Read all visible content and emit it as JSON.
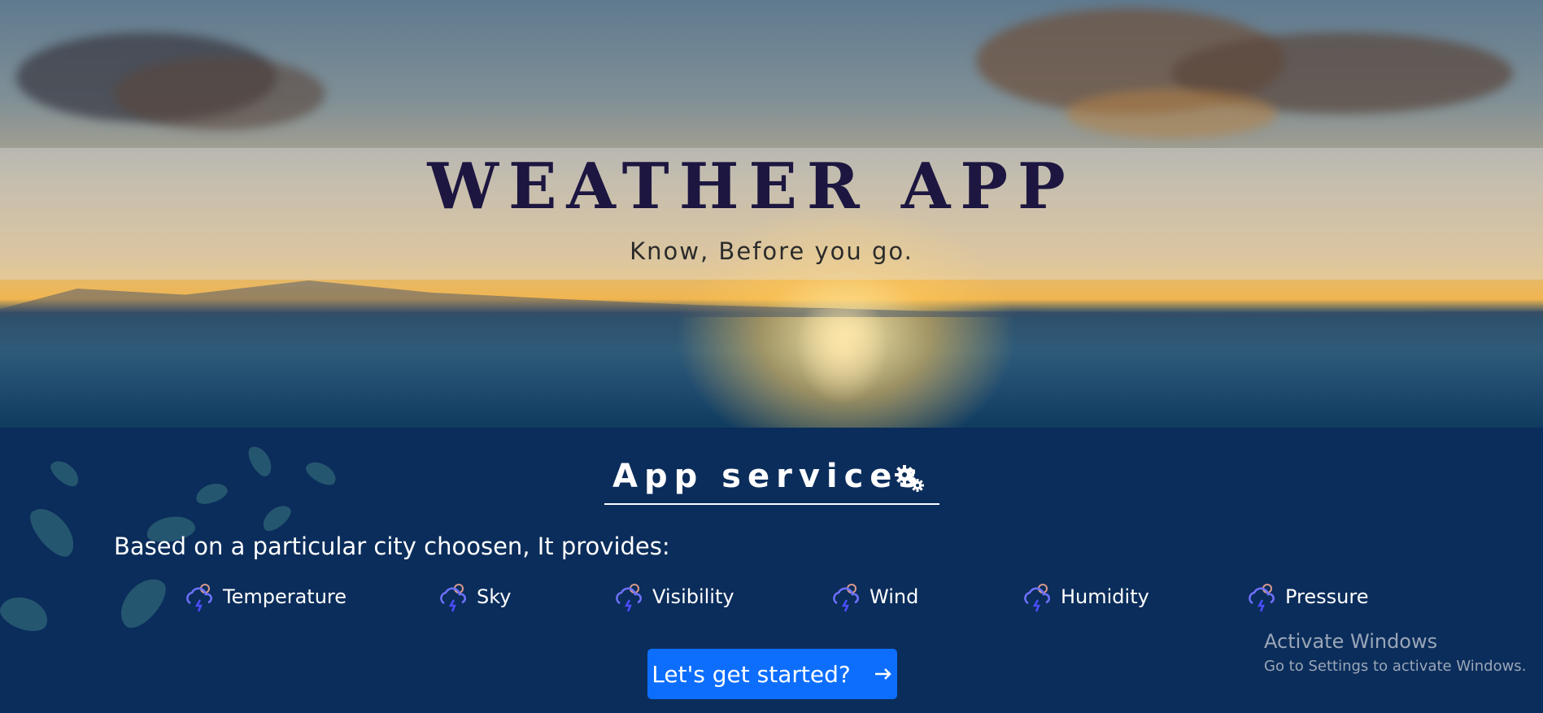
{
  "hero": {
    "title": "WEATHER APP",
    "subtitle": "Know, Before you go."
  },
  "services": {
    "heading": "App services",
    "heading_icon": "gears-icon",
    "intro": "Based on a particular city choosen, It provides:",
    "features": [
      {
        "label": "Temperature",
        "icon": "weather-storm-icon"
      },
      {
        "label": "Sky",
        "icon": "weather-storm-icon"
      },
      {
        "label": "Visibility",
        "icon": "weather-storm-icon"
      },
      {
        "label": "Wind",
        "icon": "weather-storm-icon"
      },
      {
        "label": "Humidity",
        "icon": "weather-storm-icon"
      },
      {
        "label": "Pressure",
        "icon": "weather-storm-icon"
      }
    ],
    "cta_label": "Let's get started?",
    "cta_icon": "arrow-right-icon"
  },
  "watermark": {
    "line1": "Activate Windows",
    "line2": "Go to Settings to activate Windows."
  },
  "colors": {
    "section_bg": "#0b2d5b",
    "button": "#0d6efd",
    "title": "#1c1640"
  }
}
